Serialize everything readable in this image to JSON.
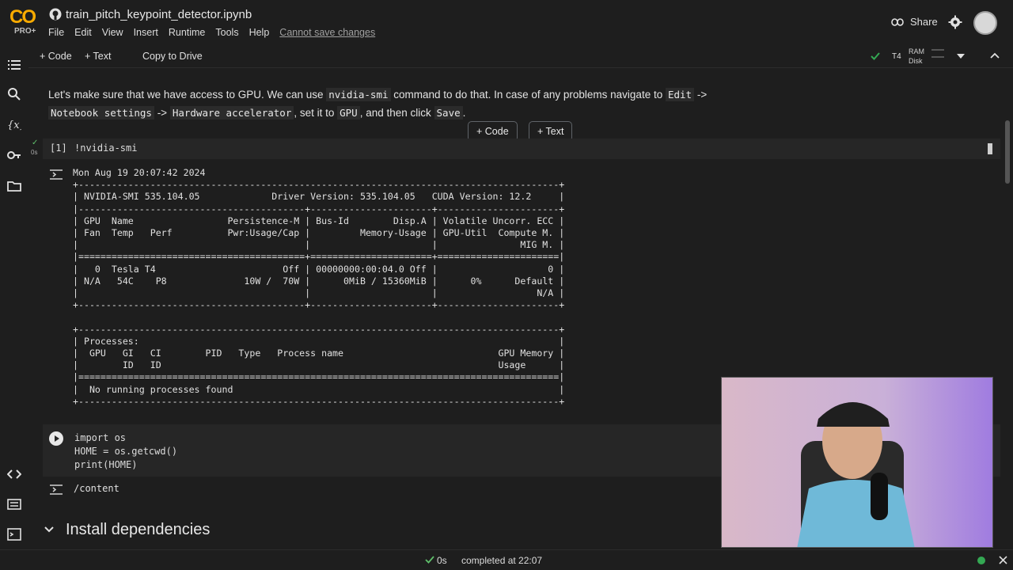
{
  "app": {
    "logo_text": "CO",
    "plan_badge": "PRO+",
    "notebook_title": "train_pitch_keypoint_detector.ipynb",
    "menu": [
      "File",
      "Edit",
      "View",
      "Insert",
      "Runtime",
      "Tools",
      "Help"
    ],
    "cannot_save": "Cannot save changes",
    "share_label": "Share"
  },
  "toolbar": {
    "code_label": "+ Code",
    "text_label": "+ Text",
    "copy_to_drive": "Copy to Drive",
    "runtime_type": "T4",
    "ram_label": "RAM",
    "disk_label": "Disk"
  },
  "intro": {
    "t1": "Let's make sure that we have access to GPU. We can use ",
    "c1": "nvidia-smi",
    "t2": " command to do that. In case of any problems navigate to ",
    "c2": "Edit",
    "t3": " -> ",
    "c3": "Notebook settings",
    "t4": " -> ",
    "c4": "Hardware accelerator",
    "t5": ", set it to ",
    "c5": "GPU",
    "t6": ", and then click ",
    "c6": "Save",
    "t7": "."
  },
  "insert_buttons": {
    "code": "+ Code",
    "text": "+ Text"
  },
  "cell1": {
    "exec_count": "[1]",
    "time": "0s",
    "code": "!nvidia-smi",
    "output_lines": [
      "Mon Aug 19 20:07:42 2024",
      "+---------------------------------------------------------------------------------------+",
      "| NVIDIA-SMI 535.104.05             Driver Version: 535.104.05   CUDA Version: 12.2     |",
      "|-----------------------------------------+----------------------+----------------------+",
      "| GPU  Name                 Persistence-M | Bus-Id        Disp.A | Volatile Uncorr. ECC |",
      "| Fan  Temp   Perf          Pwr:Usage/Cap |         Memory-Usage | GPU-Util  Compute M. |",
      "|                                         |                      |               MIG M. |",
      "|=========================================+======================+======================|",
      "|   0  Tesla T4                       Off | 00000000:00:04.0 Off |                    0 |",
      "| N/A   54C    P8              10W /  70W |      0MiB / 15360MiB |      0%      Default |",
      "|                                         |                      |                  N/A |",
      "+-----------------------------------------+----------------------+----------------------+",
      "",
      "+---------------------------------------------------------------------------------------+",
      "| Processes:                                                                            |",
      "|  GPU   GI   CI        PID   Type   Process name                            GPU Memory |",
      "|        ID   ID                                                             Usage      |",
      "|=======================================================================================|",
      "|  No running processes found                                                           |",
      "+---------------------------------------------------------------------------------------+"
    ]
  },
  "cell2": {
    "code_lines": [
      "import os",
      "HOME = os.getcwd()",
      "print(HOME)"
    ],
    "output": "/content"
  },
  "section": {
    "title": "Install dependencies"
  },
  "status": {
    "time": "0s",
    "completed": "completed at 22:07"
  },
  "colors": {
    "background": "#1e1e1e",
    "cell_bg": "#262626",
    "accent_orange": "#f9ab00",
    "success_green": "#34a853"
  }
}
